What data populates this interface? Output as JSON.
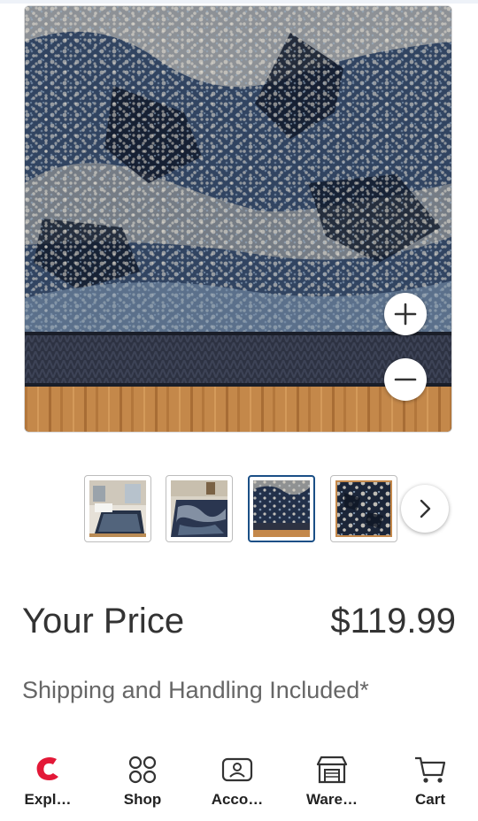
{
  "product": {
    "gallery": {
      "zoom_in_icon": "plus-icon",
      "zoom_out_icon": "minus-icon",
      "thumbnails": [
        {
          "id": "thumb-room",
          "active": false
        },
        {
          "id": "thumb-rug-floor",
          "active": false
        },
        {
          "id": "thumb-rug-edge",
          "active": true
        },
        {
          "id": "thumb-rug-pattern",
          "active": false
        }
      ],
      "next_icon": "chevron-right-icon"
    },
    "price_label": "Your Price",
    "price_value": "$119.99",
    "shipping_note": "Shipping and Handling Included*"
  },
  "nav": {
    "items": [
      {
        "label": "Expl…",
        "icon": "costco-logo-icon"
      },
      {
        "label": "Shop",
        "icon": "grid-icon"
      },
      {
        "label": "Acco…",
        "icon": "account-icon"
      },
      {
        "label": "Ware…",
        "icon": "warehouse-icon"
      },
      {
        "label": "Cart",
        "icon": "cart-icon"
      }
    ]
  },
  "colors": {
    "accent_blue": "#1a4f86",
    "brand_red": "#e31837",
    "text_dark": "#333333",
    "text_muted": "#666666"
  }
}
